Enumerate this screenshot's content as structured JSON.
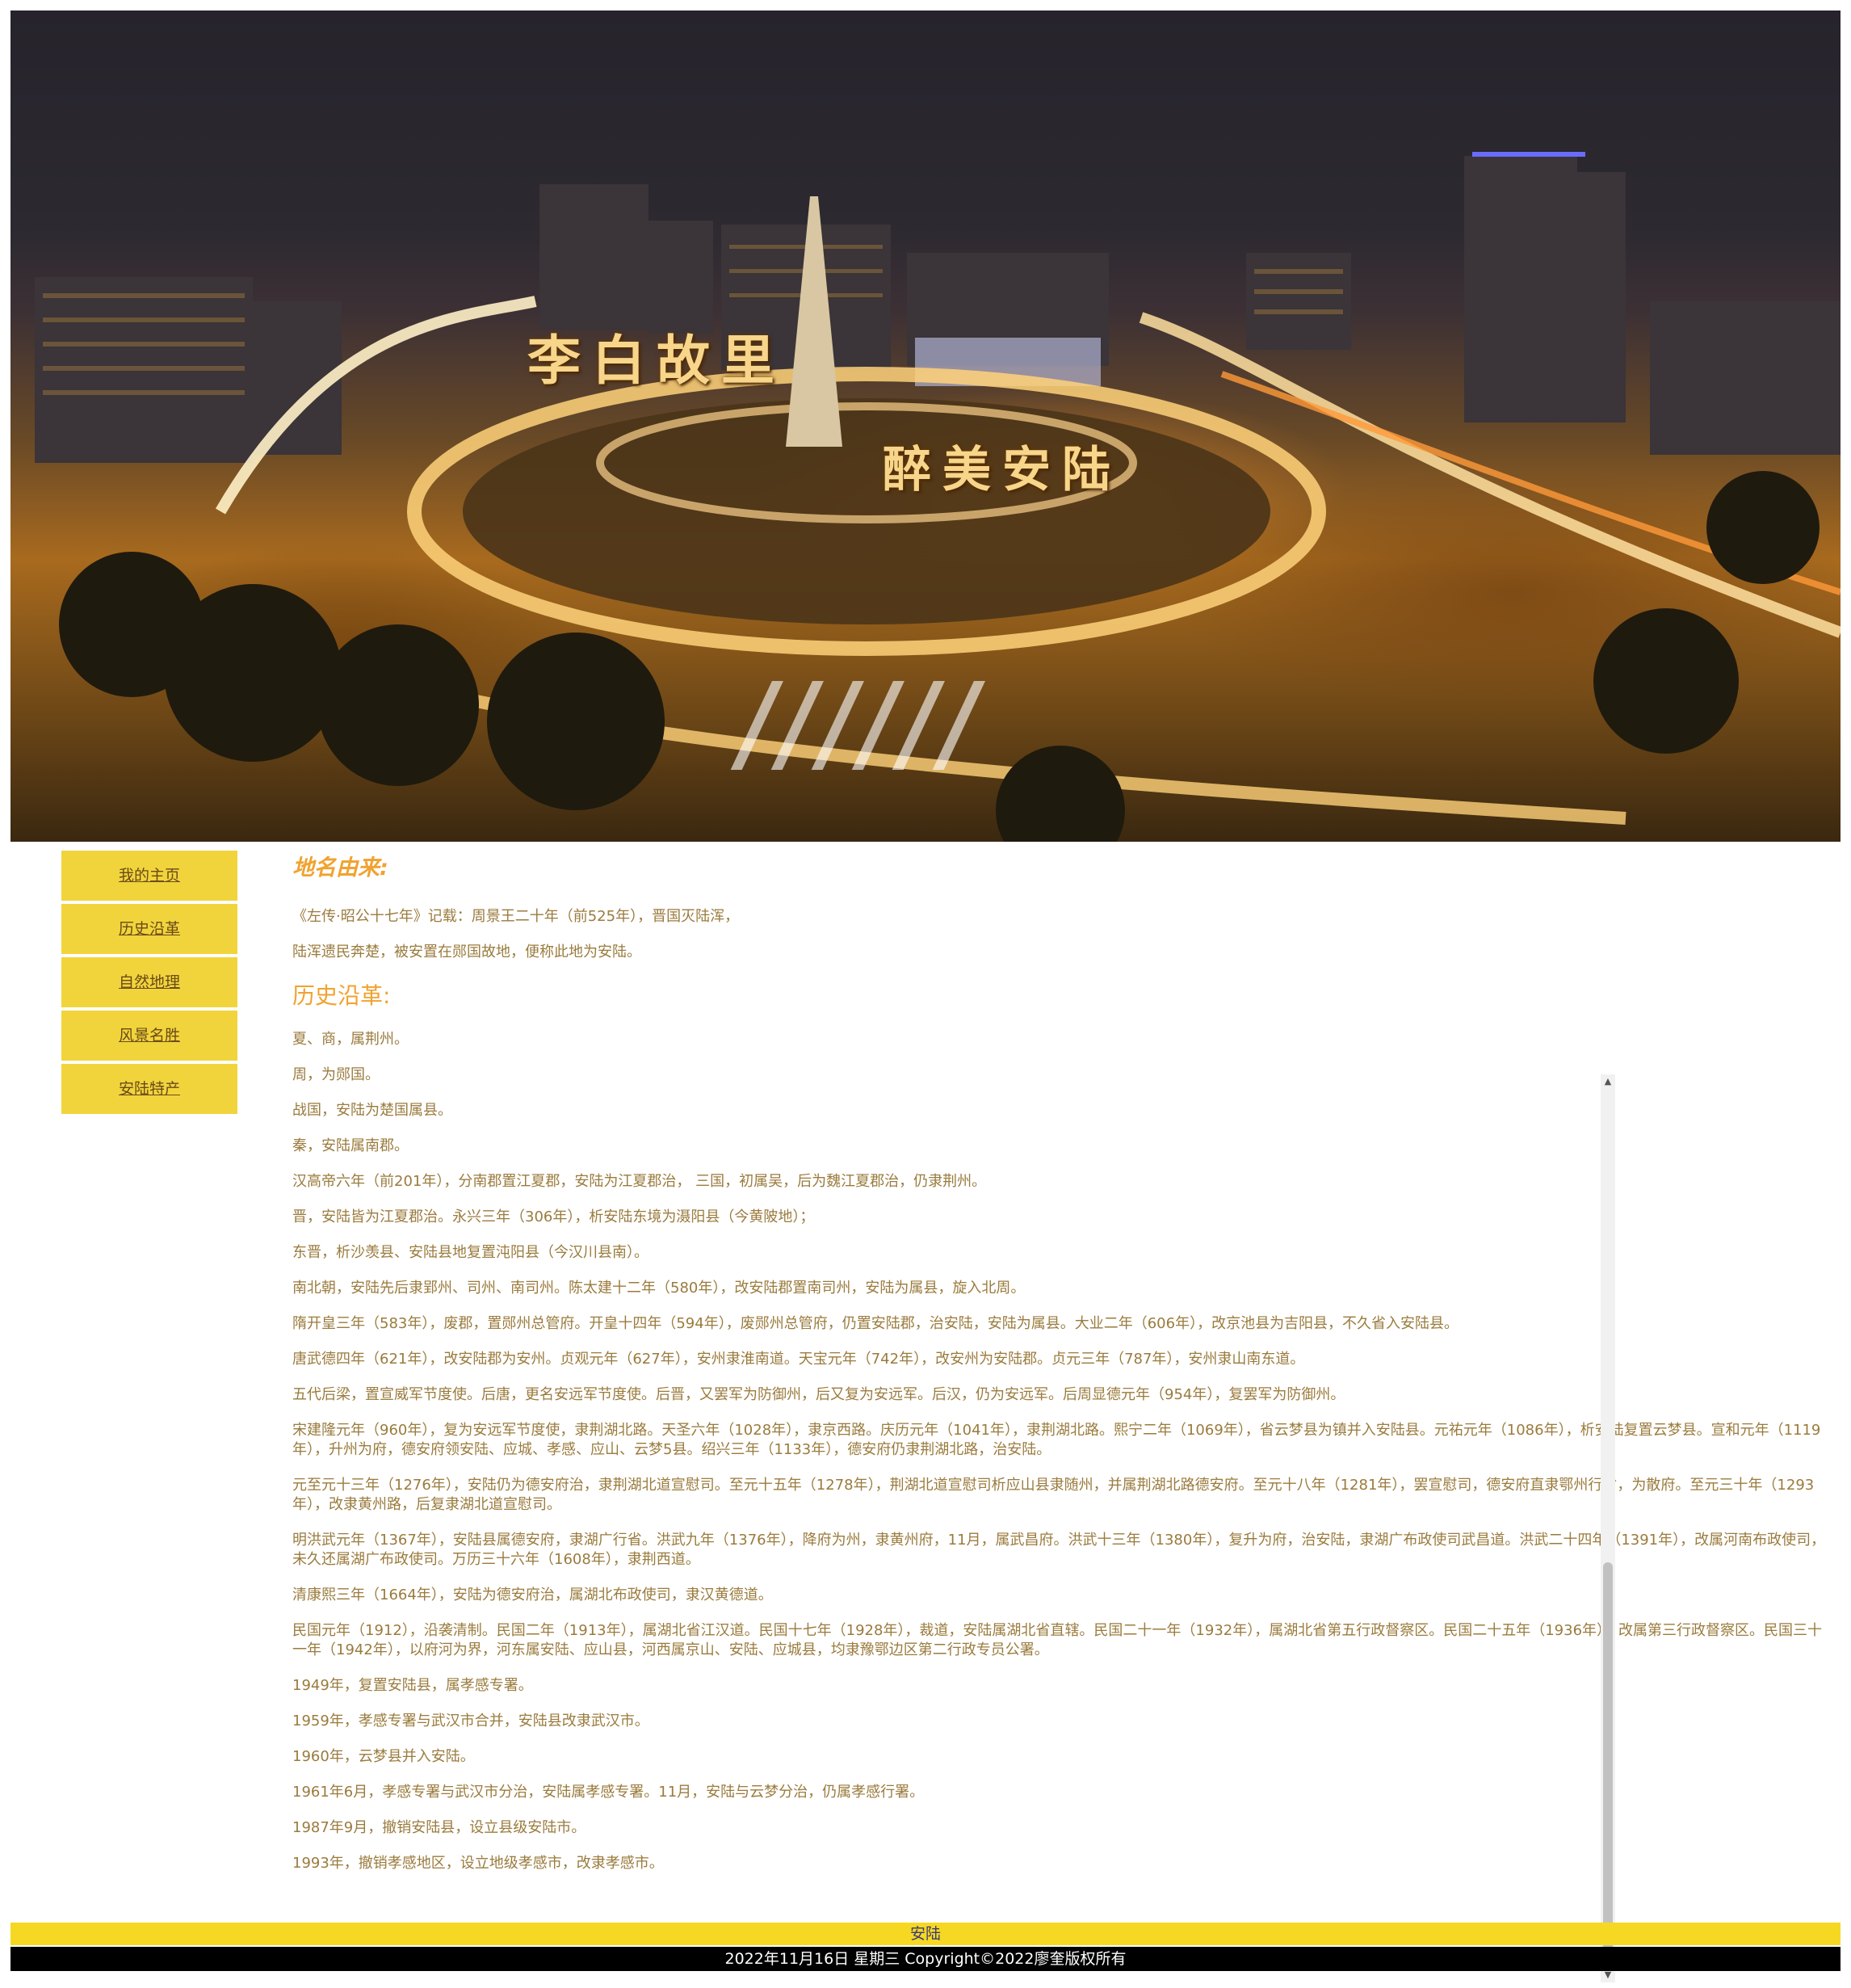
{
  "banner": {
    "slogan_left": "李白故里",
    "slogan_right": "醉美安陆"
  },
  "nav": {
    "items": [
      "我的主页",
      "历史沿革",
      "自然地理",
      "风景名胜",
      "安陆特产"
    ]
  },
  "origin": {
    "title": "地名由来:",
    "lines": [
      "《左传·昭公十七年》记载：周景王二十年（前525年），晋国灭陆浑，",
      "陆浑遗民奔楚，被安置在郧国故地，便称此地为安陆。"
    ]
  },
  "history": {
    "title": "历史沿革:",
    "items": [
      "夏、商，属荆州。",
      "周，为郧国。",
      "战国，安陆为楚国属县。",
      "秦，安陆属南郡。",
      "汉高帝六年（前201年），分南郡置江夏郡，安陆为江夏郡治， 三国，初属吴，后为魏江夏郡治，仍隶荆州。",
      "晋，安陆皆为江夏郡治。永兴三年（306年），析安陆东境为滠阳县（今黄陂地）；",
      "东晋，析沙羡县、安陆县地复置沌阳县（今汉川县南）。",
      "南北朝，安陆先后隶郢州、司州、南司州。陈太建十二年（580年），改安陆郡置南司州，安陆为属县，旋入北周。",
      "隋开皇三年（583年），废郡，置郧州总管府。开皇十四年（594年），废郧州总管府，仍置安陆郡，治安陆，安陆为属县。大业二年（606年），改京池县为吉阳县，不久省入安陆县。",
      "唐武德四年（621年），改安陆郡为安州。贞观元年（627年），安州隶淮南道。天宝元年（742年），改安州为安陆郡。贞元三年（787年），安州隶山南东道。",
      "五代后梁，置宣威军节度使。后唐，更名安远军节度使。后晋，又罢军为防御州，后又复为安远军。后汉，仍为安远军。后周显德元年（954年），复罢军为防御州。",
      "宋建隆元年（960年），复为安远军节度使，隶荆湖北路。天圣六年（1028年），隶京西路。庆历元年（1041年），隶荆湖北路。熙宁二年（1069年），省云梦县为镇并入安陆县。元祐元年（1086年），析安陆复置云梦县。宣和元年（1119年），升州为府，德安府领安陆、应城、孝感、应山、云梦5县。绍兴三年（1133年），德安府仍隶荆湖北路，治安陆。",
      "元至元十三年（1276年），安陆仍为德安府治，隶荆湖北道宣慰司。至元十五年（1278年），荆湖北道宣慰司析应山县隶随州，并属荆湖北路德安府。至元十八年（1281年），罢宣慰司，德安府直隶鄂州行省，为散府。至元三十年（1293年），改隶黄州路，后复隶湖北道宣慰司。",
      "明洪武元年（1367年），安陆县属德安府，隶湖广行省。洪武九年（1376年），降府为州，隶黄州府，11月，属武昌府。洪武十三年（1380年），复升为府，治安陆，隶湖广布政使司武昌道。洪武二十四年（1391年），改属河南布政使司，未久还属湖广布政使司。万历三十六年（1608年），隶荆西道。",
      "清康熙三年（1664年），安陆为德安府治，属湖北布政使司，隶汉黄德道。",
      "民国元年（1912），沿袭清制。民国二年（1913年），属湖北省江汉道。民国十七年（1928年），裁道，安陆属湖北省直辖。民国二十一年（1932年），属湖北省第五行政督察区。民国二十五年（1936年），改属第三行政督察区。民国三十一年（1942年），以府河为界，河东属安陆、应山县，河西属京山、安陆、应城县，均隶豫鄂边区第二行政专员公署。",
      "1949年，复置安陆县，属孝感专署。",
      "1959年，孝感专署与武汉市合并，安陆县改隶武汉市。",
      "1960年，云梦县并入安陆。",
      "1961年6月，孝感专署与武汉市分治，安陆属孝感专署。11月，安陆与云梦分治，仍属孝感行署。",
      "1987年9月，撤销安陆县，设立县级安陆市。",
      "1993年，撤销孝感地区，设立地级孝感市，改隶孝感市。"
    ]
  },
  "footer": {
    "name": "安陆",
    "copyright": "2022年11月16日 星期三 Copyright©2022廖奎版权所有"
  },
  "colors": {
    "accent_yellow": "#f1d43c",
    "heading_orange": "#f1a230",
    "body_text": "#9a7b3d",
    "footer_bar": "#f6d822"
  }
}
